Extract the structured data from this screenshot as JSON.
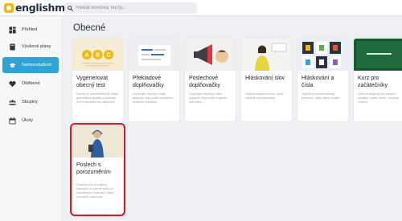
{
  "app": {
    "logo_text": "englishme!"
  },
  "search": {
    "placeholder": "Hledat slovíčka, kurzy..."
  },
  "sidebar": {
    "items": [
      {
        "label": "Přehled",
        "icon": "dashboard-icon",
        "active": false
      },
      {
        "label": "Výukové plány",
        "icon": "book-icon",
        "active": false
      },
      {
        "label": "Samoostudium",
        "icon": "graduation-cap-icon",
        "active": true
      },
      {
        "label": "Oblíbené",
        "icon": "heart-icon",
        "active": false
      },
      {
        "label": "Skupiny",
        "icon": "group-icon",
        "active": false
      },
      {
        "label": "Úkoly",
        "icon": "calendar-icon",
        "active": false
      }
    ]
  },
  "main": {
    "section_title": "Obecné",
    "cards": [
      {
        "title": "Vygenerovat obecný test",
        "desc": "Nechte si vytvořit test na různé gramatická témata a lexikální jevy s vysvětlením odpovědí."
      },
      {
        "title": "Překladové doplňovačky",
        "desc": "Doplňujte chybějící části anglické věty podle zadaného českého překladu."
      },
      {
        "title": "Poslechové doplňovačky",
        "desc": "Doplňujte chybějící části anglické věty podle anglické nahrávky."
      },
      {
        "title": "Hláskování slov",
        "desc": "Napište správně slovo, které uslyšíte vyhláskované."
      },
      {
        "title": "Hláskování a čísla",
        "desc": "Zapište si nahlas pomaly písmena, čísla, které slyšíte."
      },
      {
        "title": "Kurz pro začátečníky",
        "desc": "Učte se anglicky od úplného začátku, krátké lekce, spousty cvičení."
      },
      {
        "title": "Poslech s porozuměním",
        "desc": "Poslechněte si krátkou nahrávku a vyberte jednu z nabízených možností, která nahrávce odpovídá."
      }
    ]
  },
  "colors": {
    "accent": "#2fa3d6",
    "highlight": "#d11d25",
    "logo": "#f2b90f"
  }
}
